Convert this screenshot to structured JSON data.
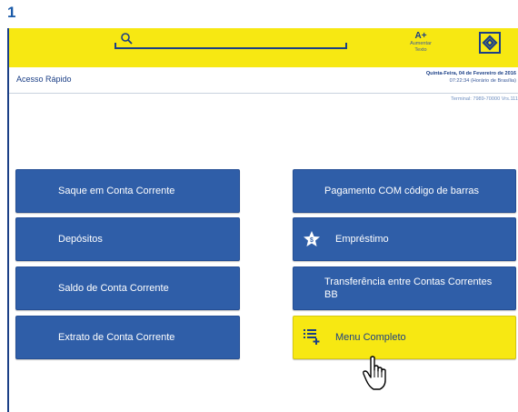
{
  "step_label": "1",
  "header": {
    "font_size_label": "A+",
    "font_size_caption_1": "Aumentar",
    "font_size_caption_2": "Texto"
  },
  "info": {
    "section_title": "Acesso Rápido",
    "date": "Quinta-Feira, 04 de Fevereiro de 2016",
    "time": "07:22:34 (Horário de Brasília)",
    "terminal": "Terminal: 7989-70000 Vrs.111"
  },
  "buttons_left": [
    {
      "label": "Saque em Conta Corrente"
    },
    {
      "label": "Depósitos"
    },
    {
      "label": "Saldo de Conta Corrente"
    },
    {
      "label": "Extrato de Conta Corrente"
    }
  ],
  "buttons_right": [
    {
      "label": "Pagamento COM código de barras"
    },
    {
      "label": "Empréstimo",
      "icon": "star-dollar-icon"
    },
    {
      "label": "Transferência entre Contas Correntes BB"
    },
    {
      "label": "Menu Completo",
      "icon": "list-add-icon"
    }
  ],
  "colors": {
    "accent_yellow": "#f7e812",
    "brand_blue": "#1b3f86",
    "button_blue": "#2f5ea8"
  }
}
